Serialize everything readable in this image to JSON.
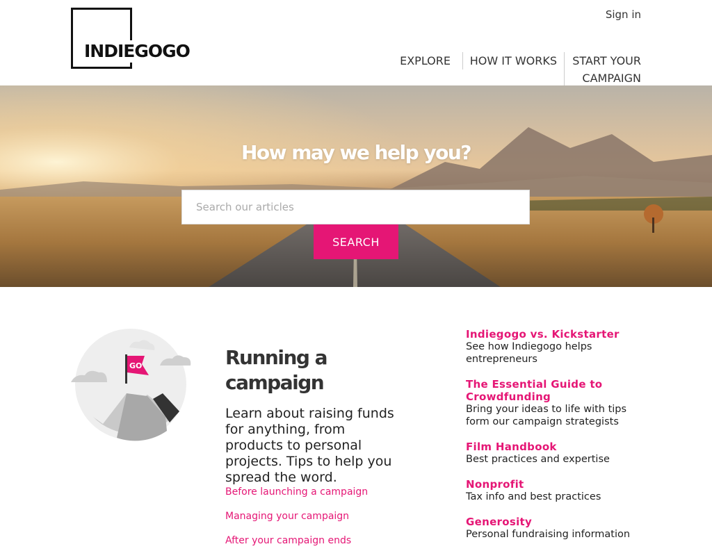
{
  "header": {
    "logo_text": "INDIEGOGO",
    "signin_label": "Sign in",
    "nav": [
      {
        "label": "EXPLORE"
      },
      {
        "label": "HOW IT WORKS"
      },
      {
        "label": "START YOUR CAMPAIGN"
      }
    ]
  },
  "hero": {
    "title": "How may we help you?",
    "search_placeholder": "Search our articles",
    "search_value": "",
    "search_button_label": "SEARCH"
  },
  "section": {
    "illustration_flag_text": "GO",
    "title": "Running a campaign",
    "description": "Learn about raising funds for anything, from products to personal projects. Tips to help you spread the word.",
    "links": [
      {
        "label": "Before launching a campaign"
      },
      {
        "label": "Managing your campaign"
      },
      {
        "label": "After your campaign ends"
      }
    ]
  },
  "guides": [
    {
      "title": "Indiegogo vs. Kickstarter",
      "desc": "See how Indiegogo helps entrepreneurs"
    },
    {
      "title": "The Essential Guide to Crowdfunding",
      "desc": "Bring your ideas to life with tips form our campaign strategists"
    },
    {
      "title": "Film Handbook",
      "desc": "Best practices and expertise"
    },
    {
      "title": "Nonprofit",
      "desc": "Tax info and best practices"
    },
    {
      "title": "Generosity",
      "desc": "Personal fundraising information"
    }
  ],
  "colors": {
    "accent": "#e51675",
    "text": "#222222"
  },
  "icons": {
    "illustration": "mountain-flag-illustration"
  }
}
